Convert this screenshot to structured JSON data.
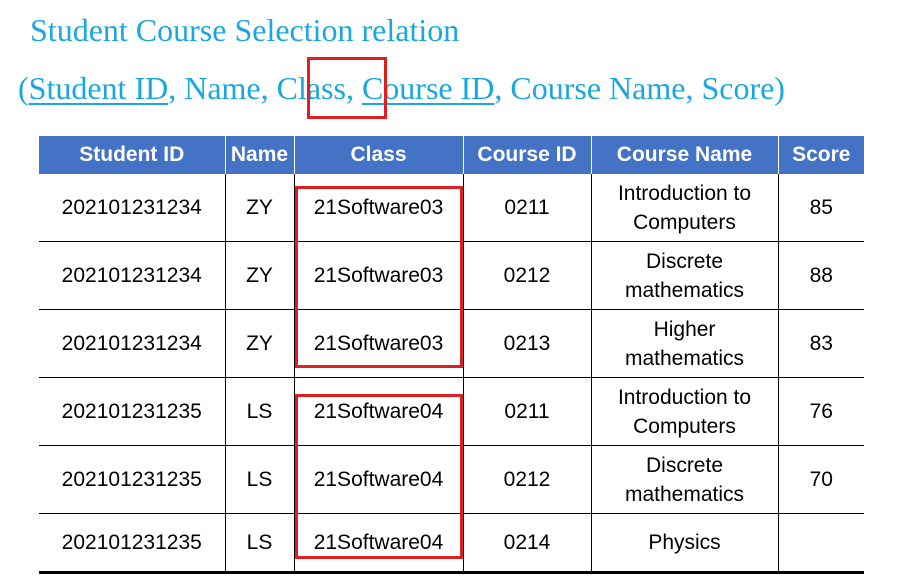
{
  "title": "Student Course Selection relation",
  "schema": {
    "open": "(",
    "attr1": "Student ID",
    "sep1": ", ",
    "attr2": "Name",
    "sep2": ", ",
    "attr3": "Class",
    "sep3": ", ",
    "attr4": "Course ID",
    "sep4": ", ",
    "attr5": "Course Name",
    "sep5": ", ",
    "attr6": "Score",
    "close": ")"
  },
  "table": {
    "headers": [
      "Student ID",
      "Name",
      "Class",
      "Course ID",
      "Course Name",
      "Score"
    ],
    "rows": [
      [
        "202101231234",
        "ZY",
        "21Software03",
        "0211",
        "Introduction to Computers",
        "85"
      ],
      [
        "202101231234",
        "ZY",
        "21Software03",
        "0212",
        "Discrete mathematics",
        "88"
      ],
      [
        "202101231234",
        "ZY",
        "21Software03",
        "0213",
        "Higher mathematics",
        "83"
      ],
      [
        "202101231235",
        "LS",
        "21Software04",
        "0211",
        "Introduction to Computers",
        "76"
      ],
      [
        "202101231235",
        "LS",
        "21Software04",
        "0212",
        "Discrete mathematics",
        "70"
      ],
      [
        "202101231235",
        "LS",
        "21Software04",
        "0214",
        "Physics",
        ""
      ]
    ]
  },
  "colors": {
    "title": "#1AA7E0",
    "header_bg": "#4472C4",
    "highlight": "#E02020"
  }
}
